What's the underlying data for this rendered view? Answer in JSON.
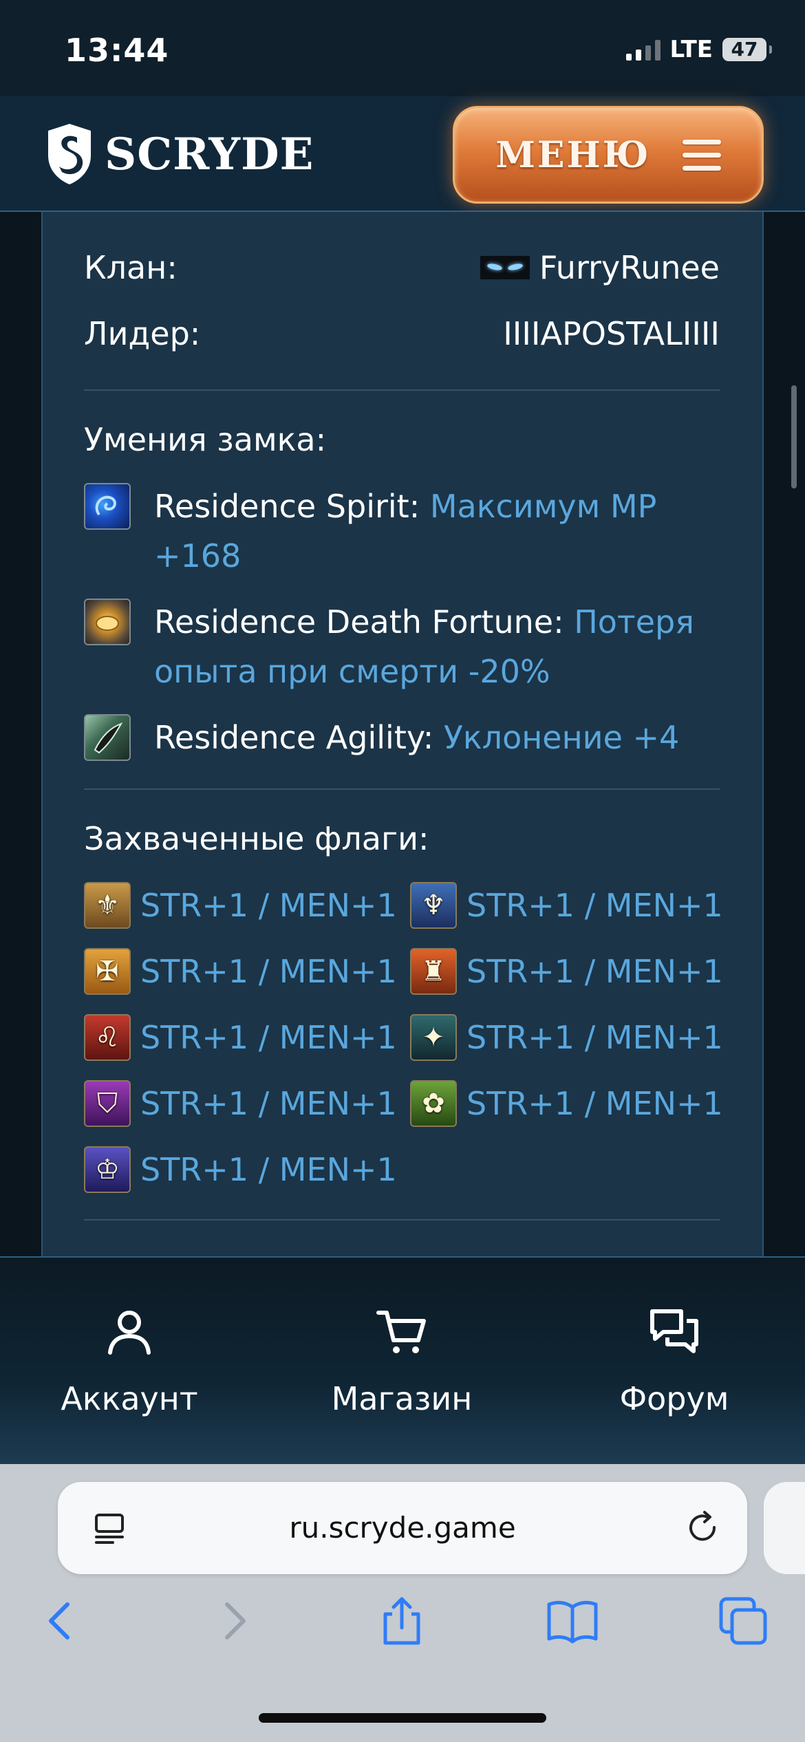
{
  "status_bar": {
    "time": "13:44",
    "network": "LTE",
    "battery": "47"
  },
  "header": {
    "brand": "SCRYDE",
    "menu_label": "МЕНЮ"
  },
  "clan_info": {
    "clan_label": "Клан:",
    "clan_value": "FurryRunee",
    "leader_label": "Лидер:",
    "leader_value": "IIIIAPOSTALIIII"
  },
  "castle_skills": {
    "title": "Умения замка:",
    "items": [
      {
        "name": "Residence Spirit",
        "effect": "Максимум MP +168",
        "icon": "spirit-icon"
      },
      {
        "name": "Residence Death Fortune",
        "effect": "Потеря опыта при смерти -20%",
        "icon": "death-fortune-icon"
      },
      {
        "name": "Residence Agility",
        "effect": "Уклонение +4",
        "icon": "agility-icon"
      }
    ]
  },
  "captured_flags": {
    "title": "Захваченные флаги:",
    "items": [
      {
        "text": "STR+1 / MEN+1",
        "icon": "fleur-de-lis-flag-icon"
      },
      {
        "text": "STR+1 / MEN+1",
        "icon": "winged-crest-flag-icon"
      },
      {
        "text": "STR+1 / MEN+1",
        "icon": "cross-flag-icon"
      },
      {
        "text": "STR+1 / MEN+1",
        "icon": "tower-flag-icon"
      },
      {
        "text": "STR+1 / MEN+1",
        "icon": "lion-flag-icon"
      },
      {
        "text": "STR+1 / MEN+1",
        "icon": "eagle-flag-icon"
      },
      {
        "text": "STR+1 / MEN+1",
        "icon": "shield-flag-icon"
      },
      {
        "text": "STR+1 / MEN+1",
        "icon": "rose-flag-icon"
      },
      {
        "text": "STR+1 / MEN+1",
        "icon": "crown-flag-icon"
      }
    ]
  },
  "bottom_nav": {
    "items": [
      {
        "label": "Аккаунт",
        "icon": "user-icon"
      },
      {
        "label": "Магазин",
        "icon": "cart-icon"
      },
      {
        "label": "Форум",
        "icon": "chat-icon"
      }
    ]
  },
  "browser": {
    "url": "ru.scryde.game"
  },
  "colors": {
    "accent_link": "#5aa7dd",
    "panel": "#1b3448",
    "menu_button": "#e07b3a"
  }
}
